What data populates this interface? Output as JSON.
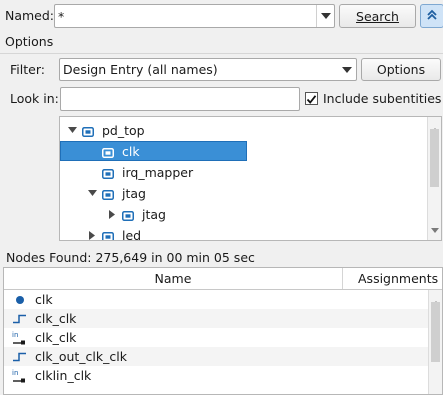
{
  "search": {
    "named_label": "Named:",
    "named_value": "*",
    "search_button": "Search",
    "collapse_icon": "double-chevron-up-icon"
  },
  "options": {
    "section_label": "Options",
    "filter_label": "Filter:",
    "filter_value": "Design Entry (all names)",
    "options_button": "Options",
    "lookin_label": "Look in:",
    "lookin_value": "",
    "include_subentities_label": "Include subentities",
    "include_subentities_checked": true
  },
  "hierarchy": [
    {
      "label": "pd_top",
      "depth": 0,
      "expander": "expanded",
      "selected": false
    },
    {
      "label": "clk",
      "depth": 1,
      "expander": "none",
      "selected": true
    },
    {
      "label": "irq_mapper",
      "depth": 1,
      "expander": "none",
      "selected": false
    },
    {
      "label": "jtag",
      "depth": 1,
      "expander": "expanded",
      "selected": false
    },
    {
      "label": "jtag",
      "depth": 2,
      "expander": "collapsed",
      "selected": false
    },
    {
      "label": "led",
      "depth": 1,
      "expander": "collapsed",
      "selected": false
    }
  ],
  "results": {
    "nodes_found": "Nodes Found: 275,649 in 00 min 05 sec",
    "columns": [
      "Name",
      "Assignments"
    ],
    "rows": [
      {
        "name": "clk",
        "icon": "dot-icon"
      },
      {
        "name": "clk_clk",
        "icon": "output-pin-icon"
      },
      {
        "name": "clk_clk",
        "icon": "input-pin-icon"
      },
      {
        "name": "clk_out_clk_clk",
        "icon": "output-pin-icon"
      },
      {
        "name": "clklin_clk",
        "icon": "input-pin-icon"
      }
    ]
  },
  "colors": {
    "selection": "#3a8fd6",
    "accent_button": "#cfe3f7",
    "entity_icon": "#1f6fb8",
    "node_icon": "#1a5fa8"
  }
}
